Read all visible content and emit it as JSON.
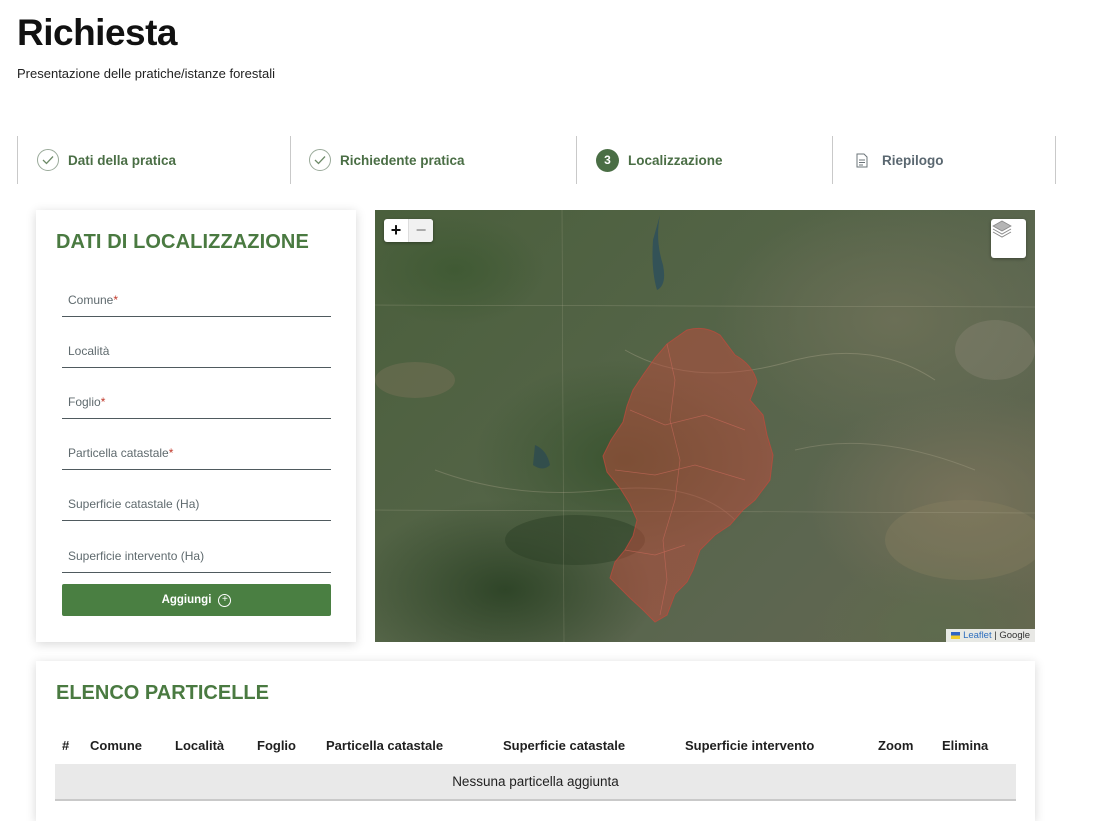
{
  "page": {
    "title": "Richiesta",
    "subtitle": "Presentazione delle pratiche/istanze forestali"
  },
  "stepper": {
    "steps": [
      {
        "label": "Dati della pratica",
        "state": "done"
      },
      {
        "label": "Richiedente pratica",
        "state": "done"
      },
      {
        "label": "Localizzazione",
        "state": "active",
        "number": "3"
      },
      {
        "label": "Riepilogo",
        "state": "pending"
      }
    ]
  },
  "form": {
    "title": "DATI DI LOCALIZZAZIONE",
    "fields": [
      {
        "label": "Comune",
        "required": "*"
      },
      {
        "label": "Località",
        "required": ""
      },
      {
        "label": "Foglio",
        "required": "*"
      },
      {
        "label": "Particella catastale",
        "required": "*"
      },
      {
        "label": "Superficie catastale (Ha)",
        "required": ""
      },
      {
        "label": "Superficie intervento (Ha)",
        "required": ""
      }
    ],
    "add_button": "Aggiungi"
  },
  "map": {
    "zoom_in": "+",
    "zoom_out": "−",
    "attribution_leaflet": "Leaflet",
    "attribution_sep": " | ",
    "attribution_provider": "Google",
    "layers_icon": "layers-icon"
  },
  "list": {
    "title": "ELENCO PARTICELLE",
    "columns": [
      "#",
      "Comune",
      "Località",
      "Foglio",
      "Particella catastale",
      "Superficie catastale",
      "Superficie intervento",
      "Zoom",
      "Elimina"
    ],
    "empty_message": "Nessuna particella aggiunta"
  },
  "colors": {
    "primary_green": "#4a7f42",
    "title_green": "#4a7a41",
    "required_red": "#c0392b",
    "parcel_overlay": "#c0493c"
  }
}
